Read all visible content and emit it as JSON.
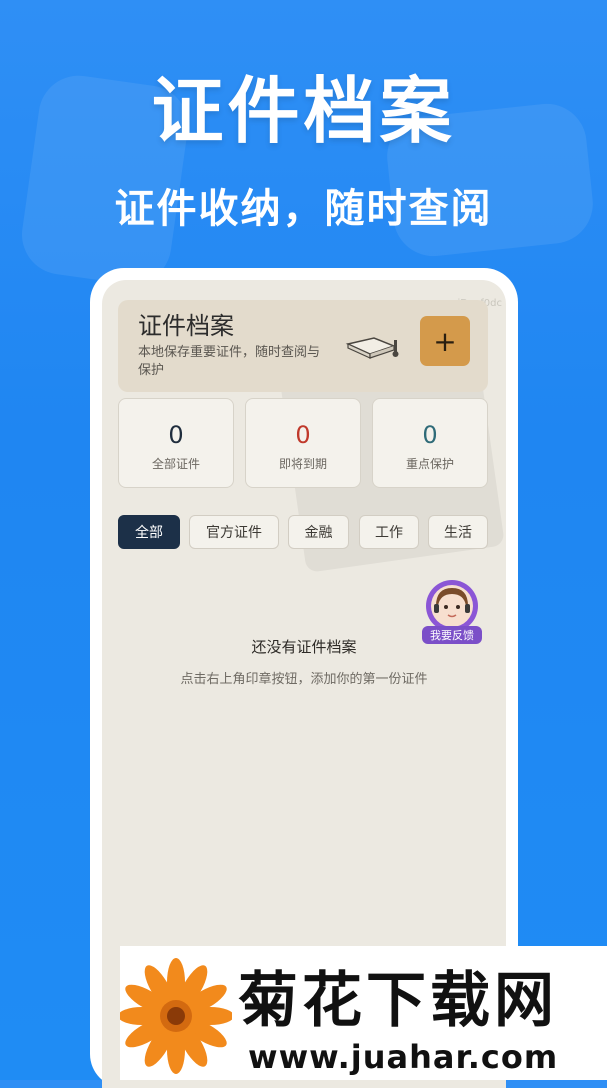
{
  "hero": {
    "title": "证件档案",
    "subtitle": "证件收纳，随时查阅"
  },
  "app": {
    "corner_id": "iDaaf0dc",
    "title": "证件档案",
    "description": "本地保存重要证件，随时查阅与保护",
    "add_button": "+"
  },
  "stats": [
    {
      "value": "0",
      "label": "全部证件",
      "color": "#1f2d3d"
    },
    {
      "value": "0",
      "label": "即将到期",
      "color": "#c0392b"
    },
    {
      "value": "0",
      "label": "重点保护",
      "color": "#2f6b78"
    }
  ],
  "tabs": [
    {
      "label": "全部",
      "active": true
    },
    {
      "label": "官方证件"
    },
    {
      "label": "金融"
    },
    {
      "label": "工作"
    },
    {
      "label": "生活"
    }
  ],
  "feedback": {
    "label": "我要反馈"
  },
  "empty_state": {
    "title": "还没有证件档案",
    "description": "点击右上角印章按钮，添加你的第一份证件"
  },
  "watermark": {
    "brand": "菊花下载网",
    "url": "www.juahar.com"
  },
  "colors": {
    "background": "#1f86f2",
    "accent": "#d49a4b",
    "active_tab": "#1c3048"
  }
}
